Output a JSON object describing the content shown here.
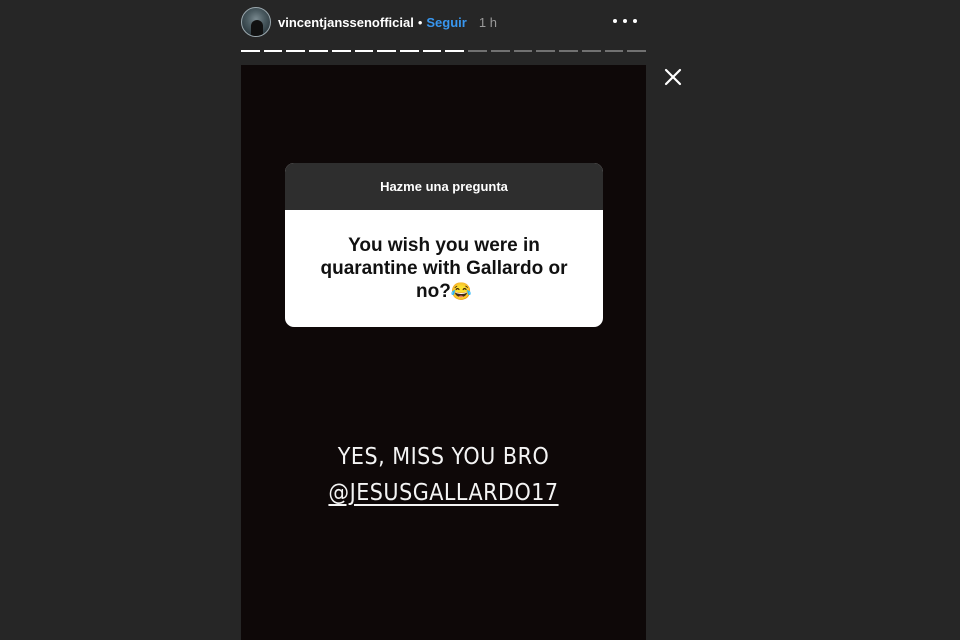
{
  "header": {
    "username": "vincentjanssenofficial",
    "separator": "•",
    "follow_label": "Seguir",
    "time": "1 h"
  },
  "progress": {
    "total_segments": 18,
    "completed_segments": 10
  },
  "question_card": {
    "title": "Hazme una pregunta",
    "question": "You wish you were in quarantine with Gallardo or no?",
    "emoji": "😂"
  },
  "answer": {
    "line1": "YES, MISS YOU BRO",
    "mention": "@JESUSGALLARDO17"
  },
  "colors": {
    "page_background": "#262626",
    "story_background": "#0e0808",
    "follow_link": "#3897f0",
    "card_header": "#2e2e2e"
  },
  "icons": [
    "avatar",
    "more-options-icon",
    "close-icon",
    "tears-of-joy-emoji"
  ]
}
